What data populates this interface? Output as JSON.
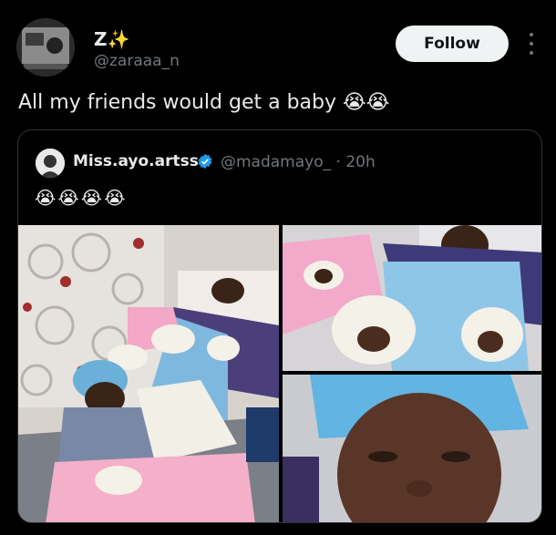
{
  "post": {
    "author_name": "Z✨",
    "author_handle": "@zaraaa_n",
    "follow_label": "Follow",
    "text": "All my friends would get a baby 😭😭"
  },
  "quoted": {
    "author_name": "Miss.ayo.artss",
    "author_handle": "@madamayo_ · 20h",
    "text": "😭😭😭😭",
    "verified_color": "#1d9bf0"
  },
  "icons": [
    "more-options-icon",
    "verified-badge-icon"
  ],
  "colors": {
    "background": "#000000",
    "text": "#e7e9ea",
    "secondary": "#71767b",
    "border": "#2f3336",
    "follow_bg": "#eff3f4"
  }
}
